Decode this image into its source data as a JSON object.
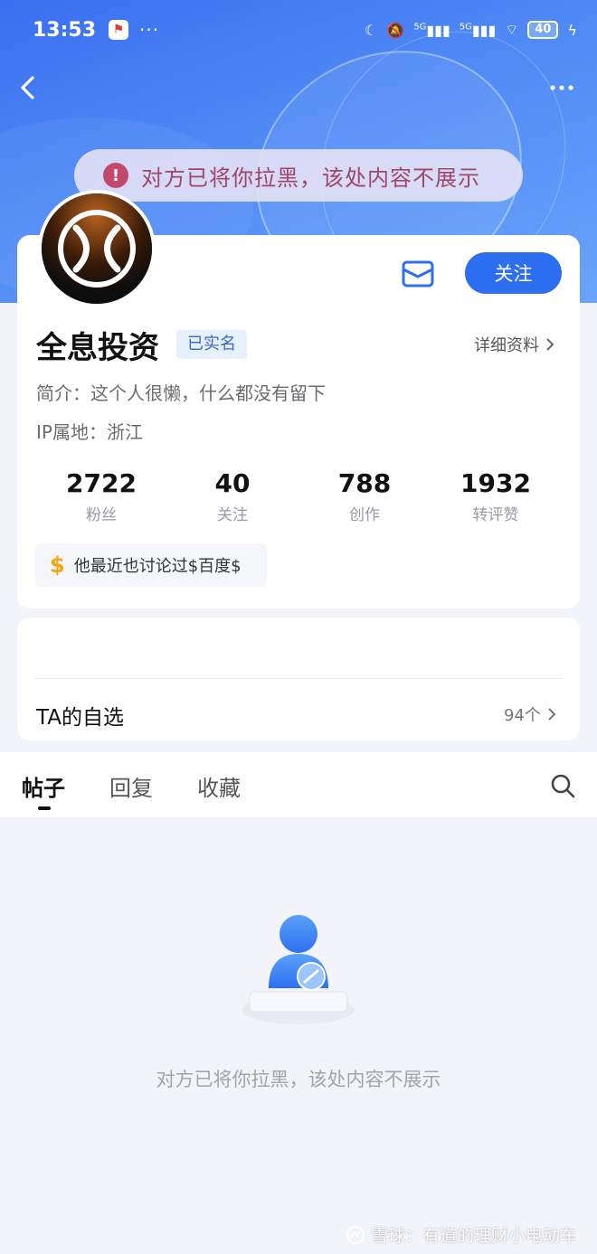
{
  "status_bar": {
    "time": "13:53",
    "dots": "···",
    "signal1": "5G",
    "signal2": "5G",
    "battery": "40"
  },
  "banner": {
    "text": "对方已将你拉黑，该处内容不展示",
    "icon": "exclamation-icon",
    "color": "#a0466a"
  },
  "profile": {
    "name": "全息投资",
    "verified_label": "已实名",
    "detail_link": "详细资料",
    "bio": "简介：这个人很懒，什么都没有留下",
    "ip": "IP属地：浙江",
    "follow_label": "关注",
    "stats": [
      {
        "value": "2722",
        "label": "粉丝"
      },
      {
        "value": "40",
        "label": "关注"
      },
      {
        "value": "788",
        "label": "创作"
      },
      {
        "value": "1932",
        "label": "转评赞"
      }
    ],
    "discussed": {
      "symbol": "$",
      "text": "他最近也讨论过$百度$"
    }
  },
  "watchlist": {
    "title": "TA的自选",
    "count": "94个"
  },
  "tabs": [
    {
      "label": "帖子",
      "active": true
    },
    {
      "label": "回复",
      "active": false
    },
    {
      "label": "收藏",
      "active": false
    }
  ],
  "empty_state": {
    "text": "对方已将你拉黑，该处内容不展示"
  },
  "watermark": {
    "text": "雪球：有道的理财小电动车"
  },
  "colors": {
    "accent": "#2e6ff2",
    "header_gradient_start": "#3a6ff0",
    "header_gradient_end": "#6aa4fb",
    "dollar": "#f2a511"
  }
}
